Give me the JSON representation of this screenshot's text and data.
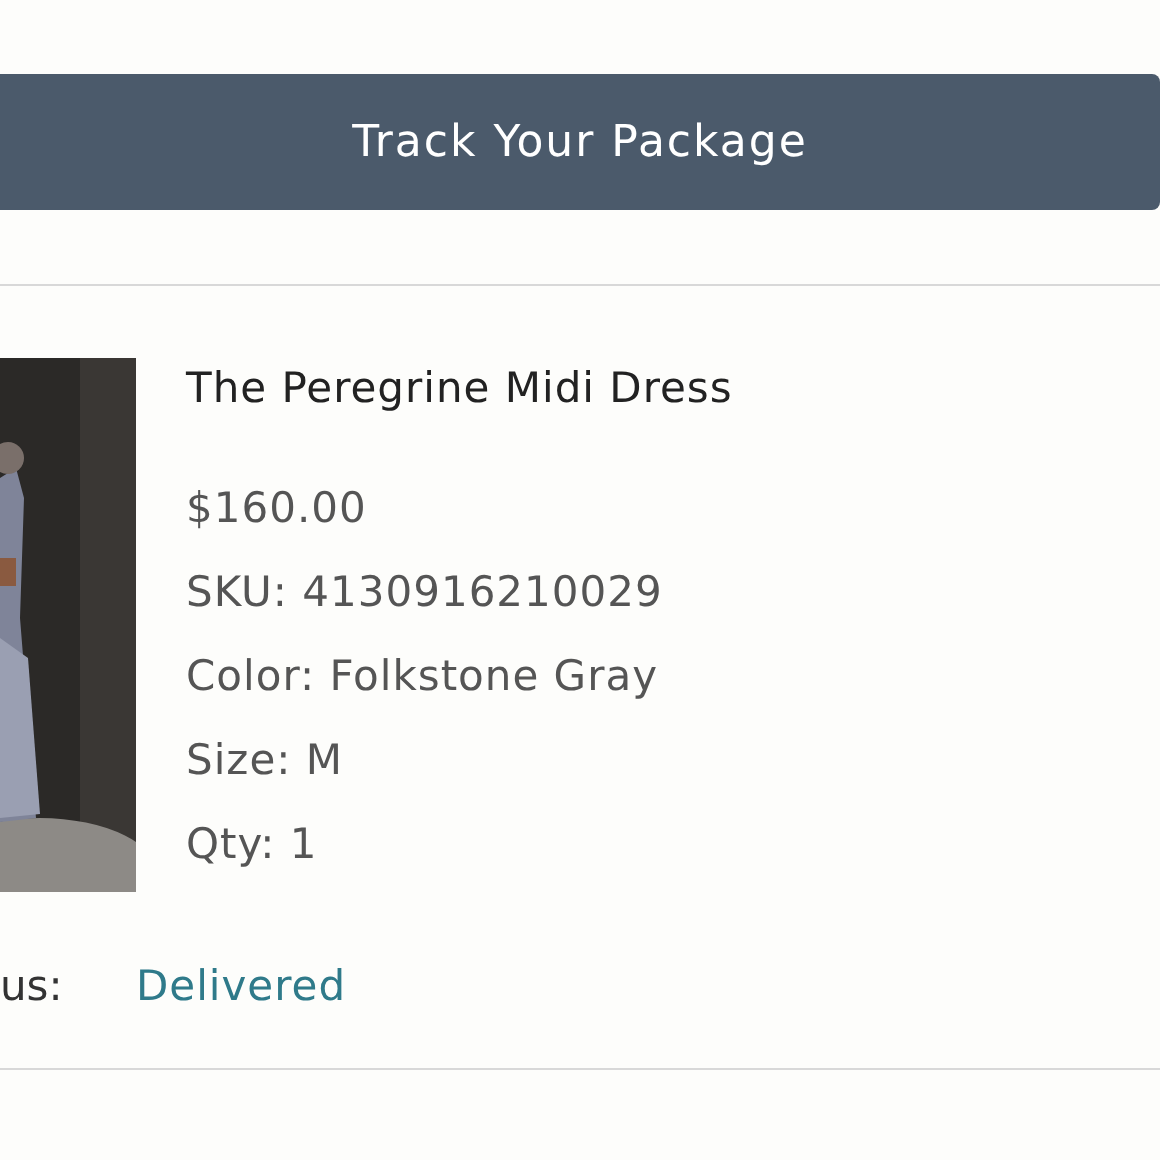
{
  "header": {
    "title": "Track Your Package"
  },
  "product": {
    "name": "The Peregrine Midi Dress",
    "price": "$160.00",
    "details": [
      "SKU: 4130916210029",
      "Color: Folkstone Gray",
      "Size: M",
      "Qty: 1"
    ]
  },
  "status": {
    "label": "us:",
    "value": "Delivered"
  }
}
